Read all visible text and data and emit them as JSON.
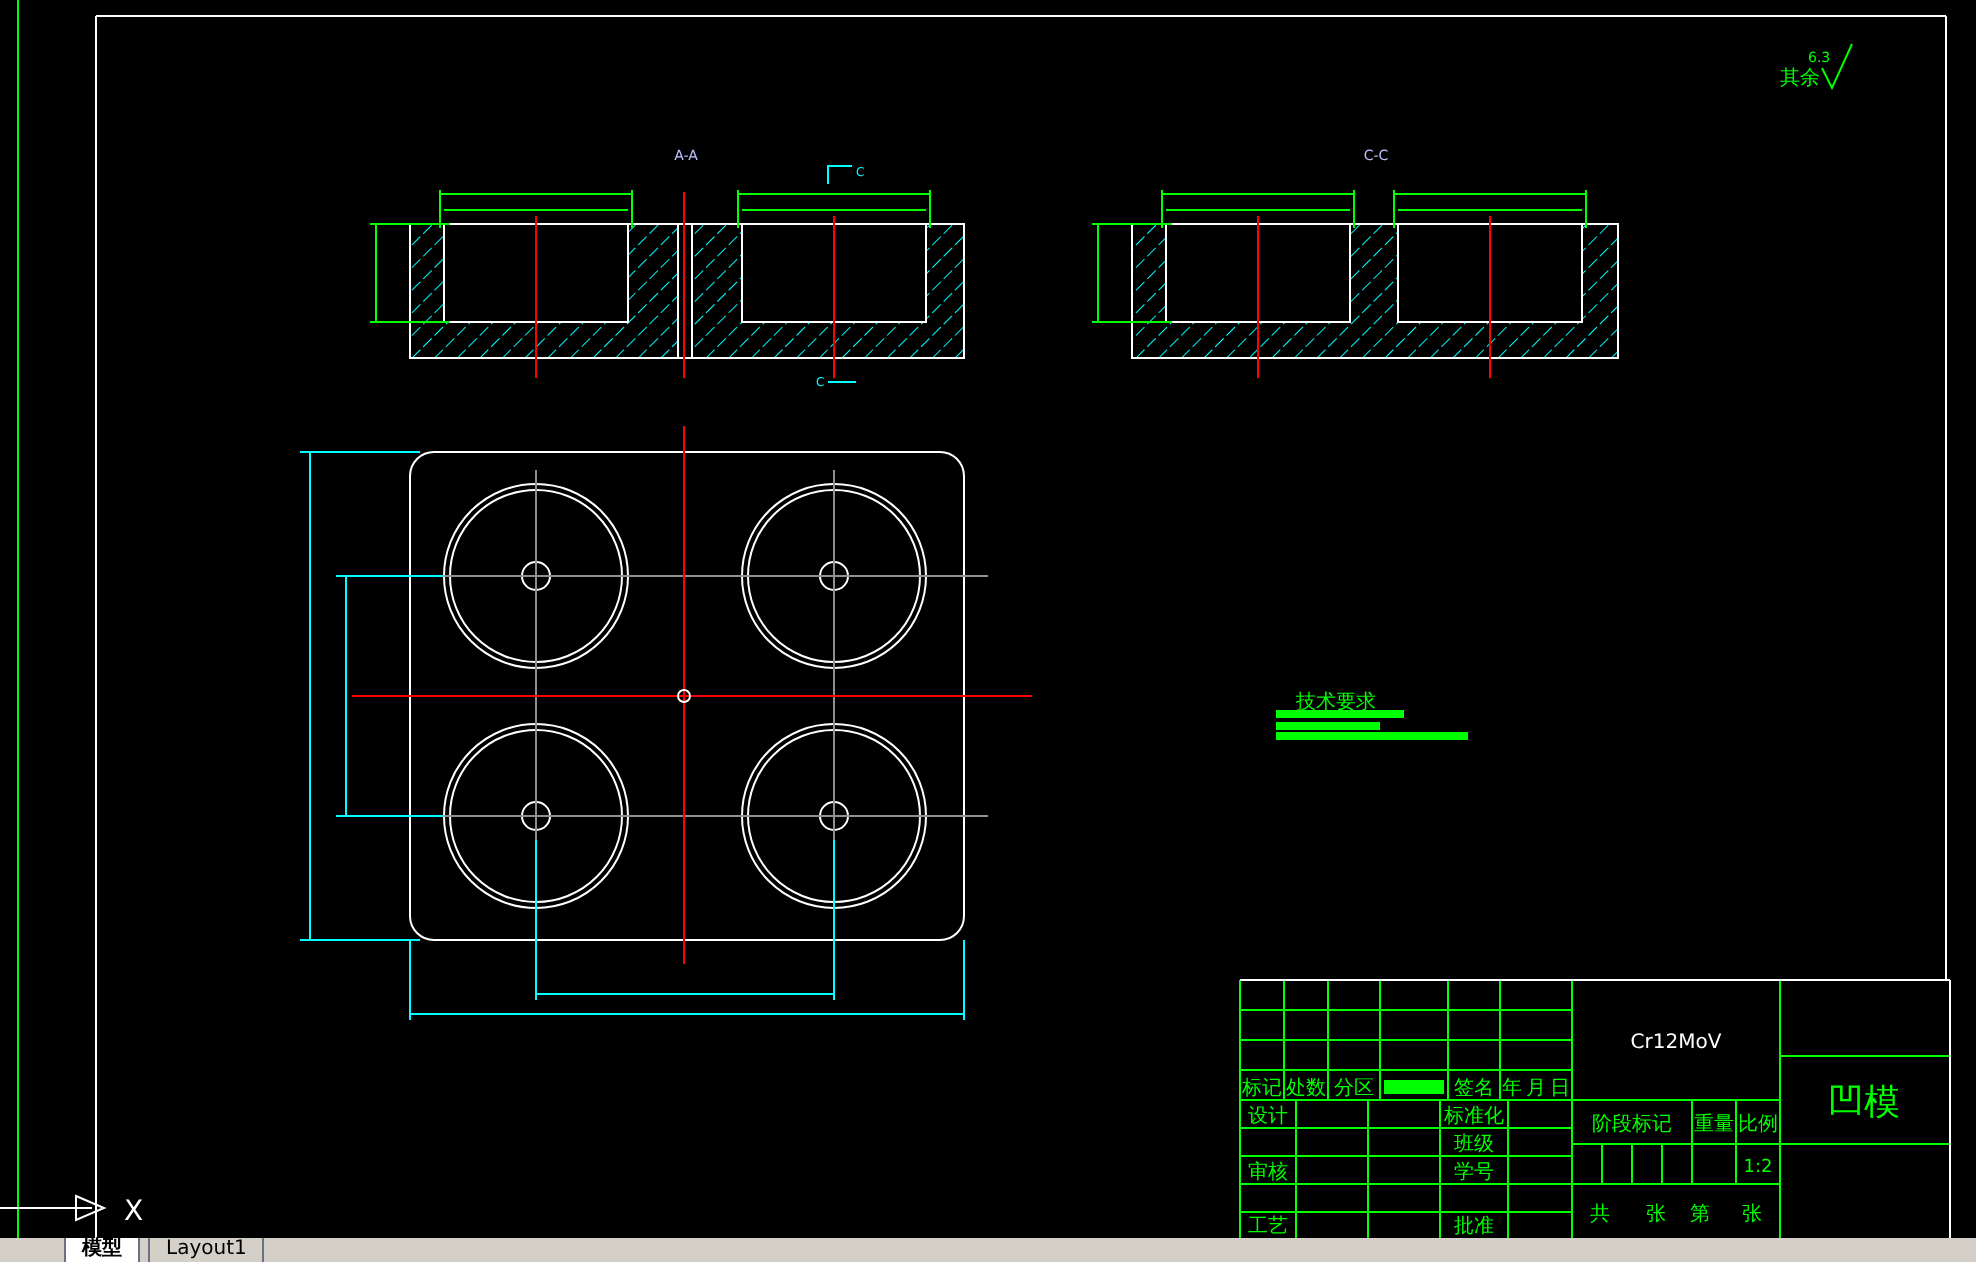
{
  "section_views": [
    {
      "label": "A-A"
    },
    {
      "label": "C-C"
    }
  ],
  "section_marks": [
    "C",
    "C"
  ],
  "surface_finish": {
    "note": "其余",
    "value": "6.3"
  },
  "tech_requirements": {
    "title": "技术要求"
  },
  "title_block": {
    "material": "Cr12MoV",
    "part_name": "凹模",
    "scale": "1:2",
    "labels": [
      "标记",
      "处数",
      "分区",
      "签名",
      "年",
      "月",
      "日",
      "设计",
      "标准化",
      "班级",
      "审核",
      "学号",
      "工艺",
      "批准",
      "阶段标记",
      "重量",
      "比例",
      "共",
      "张",
      "第",
      "张"
    ]
  },
  "ucs_axis": "X",
  "tabs": [
    {
      "label": "模型",
      "selected": true
    },
    {
      "label": "Layout1",
      "selected": false
    }
  ]
}
